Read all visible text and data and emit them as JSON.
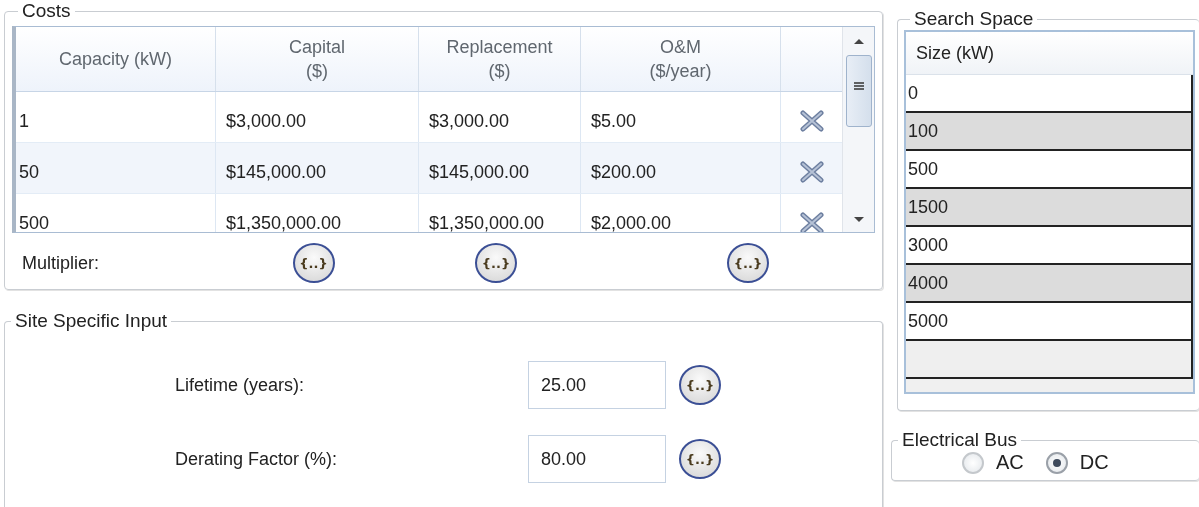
{
  "costs": {
    "title": "Costs",
    "columns": [
      {
        "lines": [
          "Capacity (kW)"
        ]
      },
      {
        "lines": [
          "Capital",
          "($)"
        ]
      },
      {
        "lines": [
          "Replacement",
          "($)"
        ]
      },
      {
        "lines": [
          "O&M",
          "($/year)"
        ]
      }
    ],
    "rows": [
      {
        "cells": [
          "1",
          "$3,000.00",
          "$3,000.00",
          "$5.00"
        ]
      },
      {
        "cells": [
          "50",
          "$145,000.00",
          "$145,000.00",
          "$200.00"
        ]
      },
      {
        "cells": [
          "500",
          "$1,350,000.00",
          "$1,350,000.00",
          "$2,000.00"
        ]
      }
    ],
    "multiplier_label": "Multiplier:",
    "multiplier_buttons": [
      "{..}",
      "{..}",
      "{..}"
    ]
  },
  "site_specific_input": {
    "title": "Site Specific Input",
    "fields": [
      {
        "label": "Lifetime (years):",
        "value": "25.00",
        "button": "{..}"
      },
      {
        "label": "Derating Factor (%):",
        "value": "80.00",
        "button": "{..}"
      }
    ]
  },
  "search_space": {
    "title": "Search Space",
    "column": "Size (kW)",
    "rows": [
      "0",
      "100",
      "500",
      "1500",
      "3000",
      "4000",
      "5000"
    ]
  },
  "electrical_bus": {
    "title": "Electrical Bus",
    "options": [
      {
        "label": "AC",
        "selected": false
      },
      {
        "label": "DC",
        "selected": true
      }
    ]
  }
}
